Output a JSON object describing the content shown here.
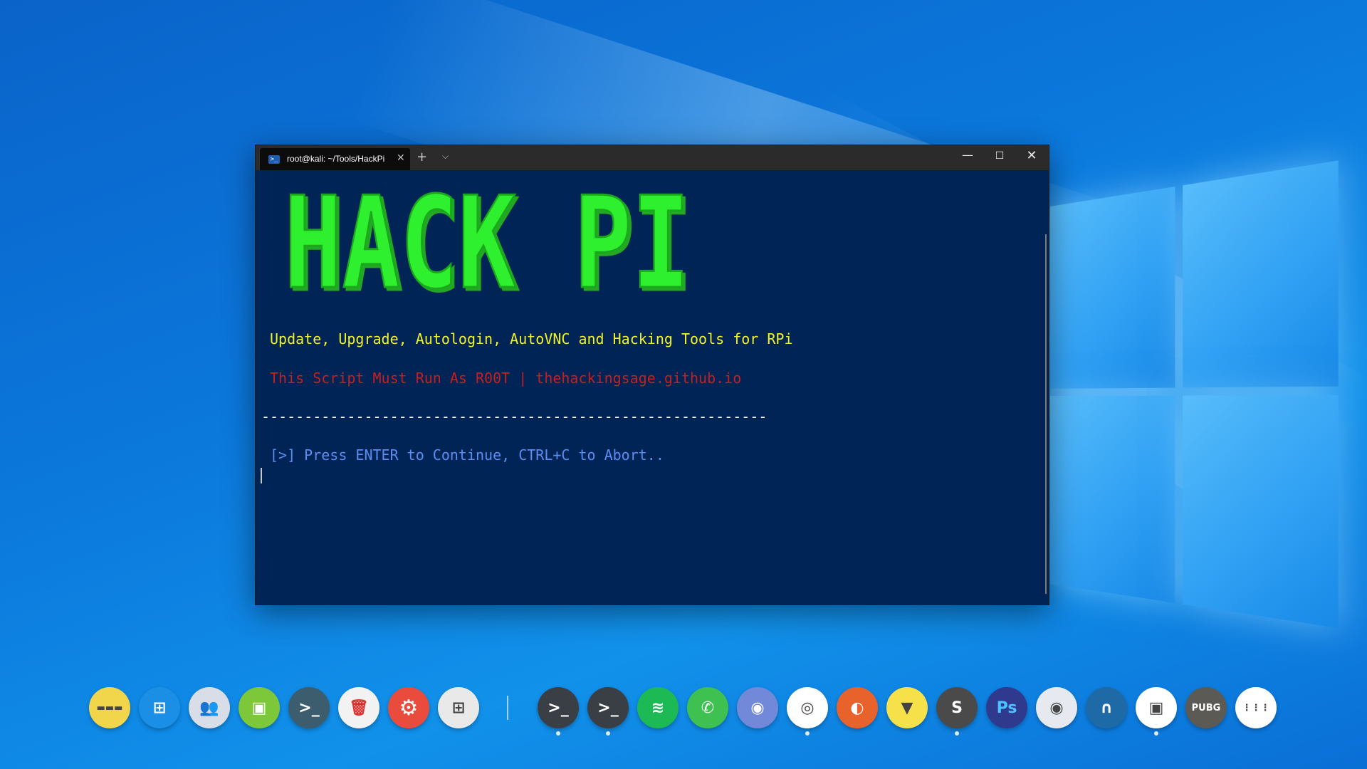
{
  "terminal": {
    "tab_title": "root@kali: ~/Tools/HackPi",
    "tab_icon": "powershell-icon",
    "new_tab_label": "+",
    "dropdown_label": "⌵",
    "close_tab_label": "✕",
    "minimize_label": "—",
    "maximize_label": "☐",
    "close_label": "✕",
    "banner_text": "HACK PI",
    "line1": "Update, Upgrade, Autologin, AutoVNC and Hacking Tools for RPi",
    "line2": "This Script Must Run As R00T | thehackingsage.github.io",
    "line3": "-----------------------------------------------------------",
    "line4": "[>] Press ENTER to Continue, CTRL+C to Abort..",
    "colors": {
      "background": "#012456",
      "banner": "#2ef02e",
      "line1": "#f3f32a",
      "line2": "#c81e1e",
      "line4": "#5b8cf0"
    }
  },
  "dock": {
    "items": [
      {
        "name": "keyboard-app-icon",
        "glyph": "▬▬▬",
        "color": "#f1d54a"
      },
      {
        "name": "windows-start-icon",
        "glyph": "⊞",
        "color": "#1b8fe6"
      },
      {
        "name": "users-icon",
        "glyph": "👥",
        "color": "#d9dde8"
      },
      {
        "name": "screen-icon",
        "glyph": "▣",
        "color": "#7dc73b"
      },
      {
        "name": "terminal-globe-icon",
        "glyph": ">_",
        "color": "#3b5d6e"
      },
      {
        "name": "trash-icon",
        "glyph": "🗑",
        "color": "#f2f2f2"
      },
      {
        "name": "settings-icon",
        "glyph": "⚙",
        "color": "#e94b3c"
      },
      {
        "name": "mixer-icon",
        "glyph": "⊞",
        "color": "#e9e9e9"
      },
      {
        "name": "terminal-icon",
        "glyph": ">_",
        "color": "#3a3f45"
      },
      {
        "name": "powershell-icon",
        "glyph": ">_",
        "color": "#3a3f45"
      },
      {
        "name": "spotify-icon",
        "glyph": "≋",
        "color": "#1db954"
      },
      {
        "name": "whatsapp-icon",
        "glyph": "✆",
        "color": "#3fc152"
      },
      {
        "name": "discord-icon",
        "glyph": "◉",
        "color": "#7289da"
      },
      {
        "name": "chrome-icon",
        "glyph": "◎",
        "color": "#ffffff"
      },
      {
        "name": "firefox-icon",
        "glyph": "◐",
        "color": "#e8632b"
      },
      {
        "name": "brave-icon",
        "glyph": "▼",
        "color": "#f7e14a"
      },
      {
        "name": "sublime-icon",
        "glyph": "S",
        "color": "#4a4a4a"
      },
      {
        "name": "photoshop-icon",
        "glyph": "Ps",
        "color": "#2f3a8f"
      },
      {
        "name": "eye-icon",
        "glyph": "◉",
        "color": "#e6e9ef"
      },
      {
        "name": "wireshark-icon",
        "glyph": "∩",
        "color": "#1d6aa7"
      },
      {
        "name": "virtualbox-icon",
        "glyph": "▣",
        "color": "#ffffff"
      },
      {
        "name": "pubg-icon",
        "glyph": "PUBG",
        "color": "#5c5a55"
      },
      {
        "name": "app-grid-icon",
        "glyph": "⋮⋮⋮",
        "color": "#ffffff"
      }
    ]
  }
}
